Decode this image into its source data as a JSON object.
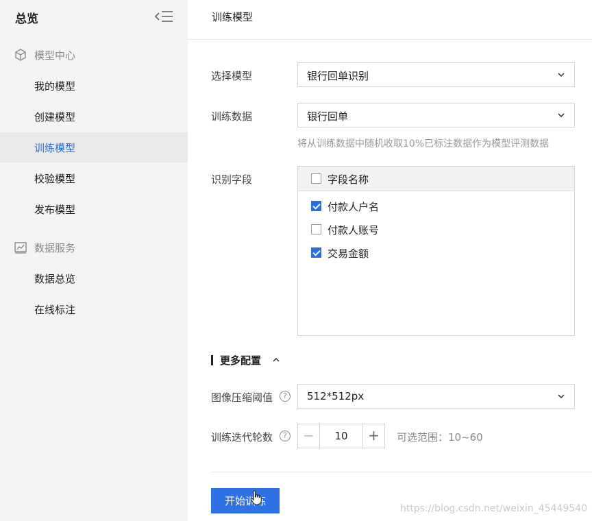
{
  "sidebar": {
    "title": "总览",
    "groups": [
      {
        "label": "模型中心",
        "icon": "cube-icon",
        "items": [
          "我的模型",
          "创建模型",
          "训练模型",
          "校验模型",
          "发布模型"
        ]
      },
      {
        "label": "数据服务",
        "icon": "chart-icon",
        "items": [
          "数据总览",
          "在线标注"
        ]
      }
    ],
    "active_item": "训练模型"
  },
  "main": {
    "title": "训练模型",
    "model_label": "选择模型",
    "model_value": "银行回单识别",
    "data_label": "训练数据",
    "data_value": "银行回单",
    "data_hint": "将从训练数据中随机收取10%已标注数据作为模型评测数据",
    "fields_label": "识别字段",
    "fields_header": "字段名称",
    "fields": [
      {
        "label": "付款人户名",
        "checked": true
      },
      {
        "label": "付款人账号",
        "checked": false
      },
      {
        "label": "交易金额",
        "checked": true
      }
    ],
    "more_config": "更多配置",
    "compress_label": "图像压缩阈值",
    "compress_value": "512*512px",
    "epochs_label": "训练迭代轮数",
    "epochs_value": "10",
    "epochs_range": "可选范围：10~60",
    "start_button": "开始训练"
  },
  "watermark": "https://blog.csdn.net/weixin_45449540",
  "colors": {
    "accent": "#2f72e8",
    "active_text": "#2f6ee5",
    "sidebar_bg": "#f3f4f5"
  }
}
